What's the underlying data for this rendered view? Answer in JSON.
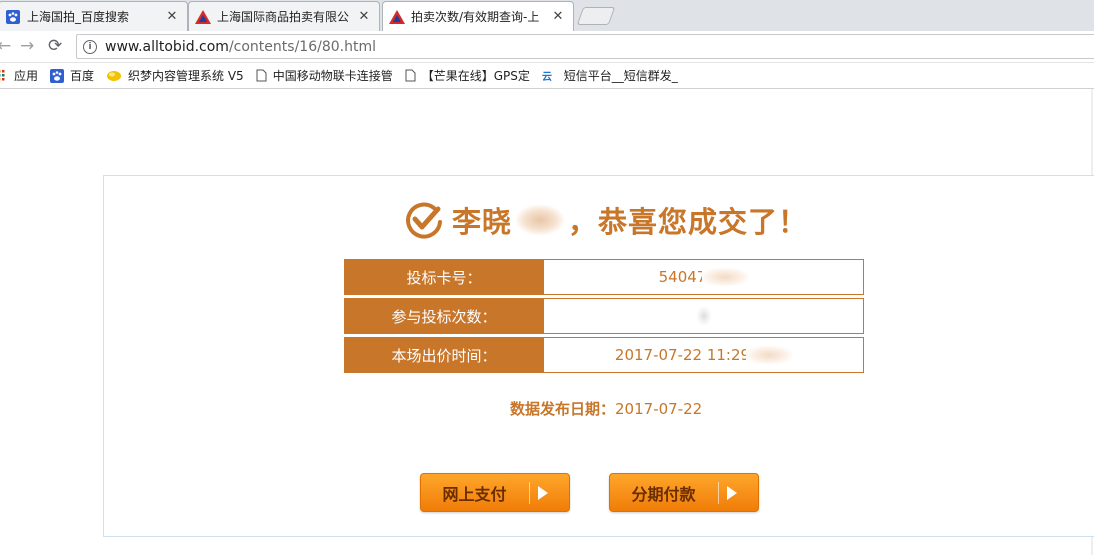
{
  "browser": {
    "tabs": [
      {
        "title": "上海国拍_百度搜索",
        "icon": "baidu-paw-icon",
        "active": false
      },
      {
        "title": "上海国际商品拍卖有限公",
        "icon": "alltobid-logo-icon",
        "active": false
      },
      {
        "title": "拍卖次数/有效期查询-上",
        "icon": "alltobid-logo-icon",
        "active": true
      }
    ],
    "tab_close_glyph": "✕",
    "url_host": "www.alltobid.com",
    "url_path": "/contents/16/80.html",
    "bookmarks": [
      {
        "label": "应用",
        "icon": "apps-grid-icon"
      },
      {
        "label": "百度",
        "icon": "baidu-paw-icon"
      },
      {
        "label": "织梦内容管理系统 V5",
        "icon": "dedecms-icon"
      },
      {
        "label": "中国移动物联卡连接管",
        "icon": "page-icon"
      },
      {
        "label": "【芒果在线】GPS定位",
        "icon": "page-icon"
      },
      {
        "label": "短信平台__短信群发_",
        "icon": "sms-platform-icon"
      }
    ]
  },
  "result": {
    "name_visible": "李晓",
    "congrats": "，恭喜您成交了！",
    "rows": [
      {
        "label": "投标卡号：",
        "value": "54047"
      },
      {
        "label": "参与投标次数：",
        "value": ""
      },
      {
        "label": "本场出价时间：",
        "value": "2017-07-22 11:29"
      }
    ],
    "publish_label": "数据发布日期：",
    "publish_date": "2017-07-22",
    "buttons": {
      "pay_online": "网上支付",
      "installment": "分期付款"
    }
  },
  "colors": {
    "accent": "#c8762a",
    "button_orange": "#f8921a"
  }
}
